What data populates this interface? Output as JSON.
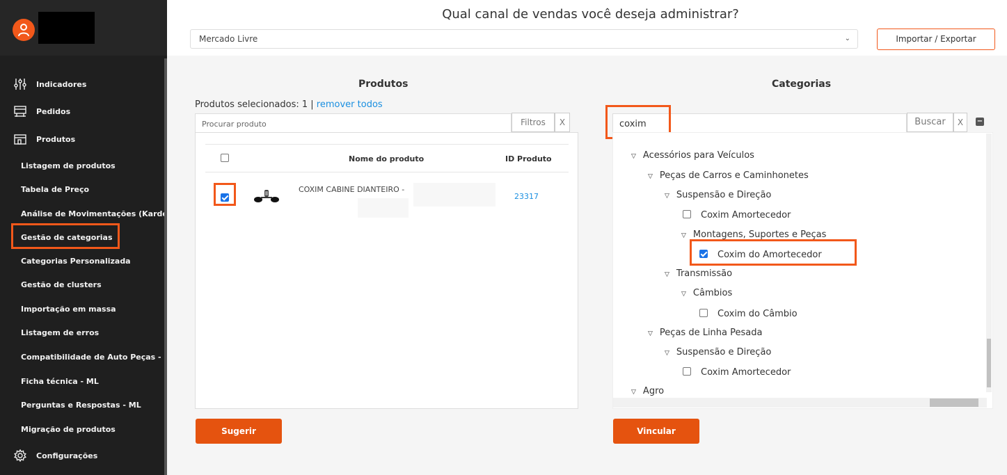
{
  "sidebar": {
    "nav": [
      {
        "label": "Indicadores",
        "icon": "sliders-icon"
      },
      {
        "label": "Pedidos",
        "icon": "orders-icon"
      },
      {
        "label": "Produtos",
        "icon": "box-icon"
      }
    ],
    "sub_items": [
      "Listagem de produtos",
      "Tabela de Preço",
      "Análise de Movimentações (Kardex)",
      "Gestão de categorias",
      "Categorias Personalizada",
      "Gestão de clusters",
      "Importação em massa",
      "Listagem de erros",
      "Compatibilidade de Auto Peças - ML",
      "Ficha técnica - ML",
      "Perguntas e Respostas - ML",
      "Migração de produtos"
    ],
    "settings_label": "Configurações",
    "active_item": "Gestão de categorias"
  },
  "header": {
    "title": "Qual canal de vendas você deseja administrar?",
    "channel_value": "Mercado Livre",
    "import_export_label": "Importar / Exportar"
  },
  "products": {
    "title": "Produtos",
    "selected_text": "Produtos selecionados: 1 |",
    "remove_all_label": "remover todos",
    "search_placeholder": "Procurar produto",
    "filters_label": "Filtros",
    "clear_label": "X",
    "columns": {
      "name": "Nome do produto",
      "id": "ID Produto"
    },
    "rows": [
      {
        "name": "COXIM CABINE DIANTEIRO -",
        "id": "23317",
        "checked": true
      }
    ],
    "suggest_label": "Sugerir"
  },
  "categories": {
    "title": "Categorias",
    "search_value": "coxim",
    "search_label": "Buscar",
    "clear_label": "X",
    "collapse_label": "−",
    "tree": [
      {
        "label": "Acessórios para Veículos",
        "level": 0,
        "type": "node"
      },
      {
        "label": "Peças de Carros e Caminhonetes",
        "level": 1,
        "type": "node"
      },
      {
        "label": "Suspensão e Direção",
        "level": 2,
        "type": "node"
      },
      {
        "label": "Coxim Amortecedor",
        "level": 3,
        "type": "leaf",
        "checked": false
      },
      {
        "label": "Montagens, Suportes e Peças",
        "level": 3,
        "type": "node"
      },
      {
        "label": "Coxim do Amortecedor",
        "level": 4,
        "type": "leaf",
        "checked": true
      },
      {
        "label": "Transmissão",
        "level": 2,
        "type": "node"
      },
      {
        "label": "Câmbios",
        "level": 3,
        "type": "node"
      },
      {
        "label": "Coxim do Câmbio",
        "level": 4,
        "type": "leaf",
        "checked": false
      },
      {
        "label": "Peças de Linha Pesada",
        "level": 1,
        "type": "node"
      },
      {
        "label": "Suspensão e Direção",
        "level": 2,
        "type": "node"
      },
      {
        "label": "Coxim Amortecedor",
        "level": 3,
        "type": "leaf",
        "checked": false
      },
      {
        "label": "Agro",
        "level": 0,
        "type": "node"
      }
    ],
    "link_label": "Vincular"
  },
  "colors": {
    "accent": "#f2581a",
    "sidebar": "#1f1f1f",
    "link": "#1a8fe0"
  }
}
